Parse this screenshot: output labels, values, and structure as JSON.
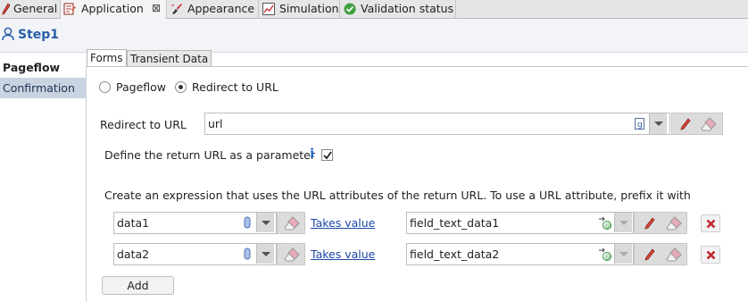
{
  "top_tabs": [
    {
      "label": "General"
    },
    {
      "label": "Application",
      "close": "⊠"
    },
    {
      "label": "Appearance"
    },
    {
      "label": "Simulation"
    },
    {
      "label": "Validation status"
    }
  ],
  "header": {
    "title": "Step1"
  },
  "nav": {
    "items": [
      {
        "label": "Pageflow"
      },
      {
        "label": "Confirmation"
      }
    ]
  },
  "inner_tabs": [
    {
      "label": "Forms"
    },
    {
      "label": "Transient Data"
    }
  ],
  "mode": {
    "option_pageflow": "Pageflow",
    "option_redirect": "Redirect to URL",
    "selected": "Redirect to URL"
  },
  "redirect": {
    "label": "Redirect to URL",
    "value": "url"
  },
  "return_param": {
    "label": "Define the return URL as a parameter",
    "info_icon": "ℹ",
    "checked": true
  },
  "instruction": "Create an expression that uses the URL attributes of the return URL. To use a URL attribute, prefix it with",
  "rows": [
    {
      "name": "data1",
      "link": "Takes value",
      "value": "field_text_data1"
    },
    {
      "name": "data2",
      "link": "Takes value",
      "value": "field_text_data2"
    }
  ],
  "add_label": "Add",
  "colors": {
    "accent": "#2a5da8",
    "nav_selected_bg": "#c9d3e2",
    "link": "#1a47a8",
    "delete": "#c0282d"
  }
}
